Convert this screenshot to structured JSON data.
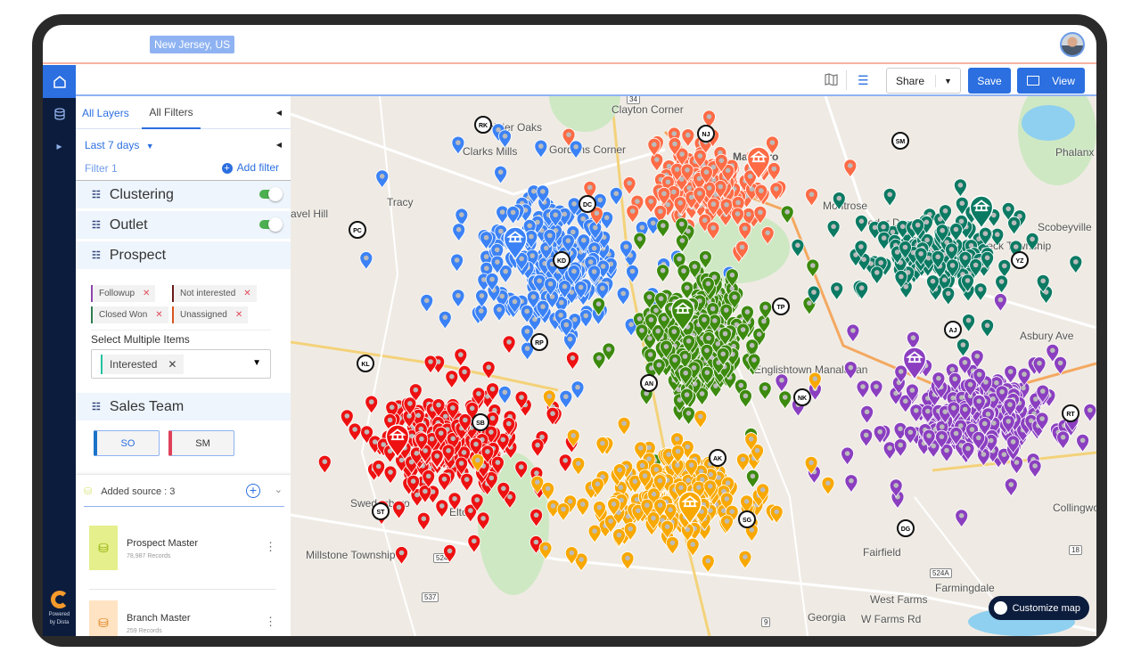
{
  "header": {
    "location": "New Jersey, US"
  },
  "toolbar": {
    "share_label": "Share",
    "save_label": "Save",
    "view_label": "View"
  },
  "panel": {
    "tabs": [
      {
        "label": "All Layers"
      },
      {
        "label": "All Filters"
      }
    ],
    "date_range": "Last 7 days",
    "filter_title": "Filter 1",
    "add_filter": "Add filter",
    "sections": {
      "clustering": "Clustering",
      "outlet": "Outlet",
      "prospect": "Prospect",
      "sales_team": "Sales Team"
    },
    "toggles": {
      "clustering": true,
      "outlet": true
    },
    "chips": [
      {
        "label": "Followup",
        "color": "#8e44ad"
      },
      {
        "label": "Not interested",
        "color": "#6b1a1a"
      },
      {
        "label": "Closed Won",
        "color": "#2e7d4f"
      },
      {
        "label": "Unassigned",
        "color": "#d9541e"
      }
    ],
    "select_label": "Select Multiple Items",
    "selected": "Interested",
    "team_buttons": [
      {
        "label": "SO",
        "color": "#1a73c8"
      },
      {
        "label": "SM",
        "color": "#e0405a"
      }
    ],
    "sources": {
      "header": "Added source : 3",
      "items": [
        {
          "name": "Prospect Master",
          "records": "78,987 Records",
          "color": "#e5ef8c",
          "icon_color": "#8fae00"
        },
        {
          "name": "Branch Master",
          "records": "259 Records",
          "color": "#ffe3c2",
          "icon_color": "#e0801a"
        }
      ]
    }
  },
  "logo": {
    "text1": "Powered",
    "text2": "by Dista"
  },
  "map": {
    "places": [
      "Whittier Oaks",
      "Clarks Mills",
      "Gordons Corner",
      "Clayton Corner",
      "Tracy",
      "avel Hill",
      "Marlboro",
      "Montrose",
      "Cedar Dr",
      "Colts Neck Township",
      "Scobeyville",
      "Phalanx",
      "Englishtown Manalapan",
      "Asbury Ave",
      "Collingwood Park",
      "Millstone Township",
      "Fairfield",
      "Farmingdale",
      "West Farms",
      "W Farms Rd",
      "Georgia",
      "Swedesboro",
      "Elton"
    ],
    "route_shields": [
      "34",
      "524",
      "537",
      "524A",
      "9",
      "18"
    ],
    "clusters": [
      {
        "name": "blue",
        "color": "#3b82f6"
      },
      {
        "name": "orange",
        "color": "#ff6b45"
      },
      {
        "name": "green",
        "color": "#3c8a0e"
      },
      {
        "name": "teal",
        "color": "#0b7a63"
      },
      {
        "name": "purple",
        "color": "#8b3fc0"
      },
      {
        "name": "red",
        "color": "#ee1111"
      },
      {
        "name": "yellow",
        "color": "#f9a800"
      }
    ],
    "user_markers": [
      "RK",
      "DC",
      "PC",
      "KD",
      "RP",
      "KL",
      "NJ",
      "SM",
      "YZ",
      "AJ",
      "TP",
      "AN",
      "NK",
      "SB",
      "AK",
      "ST",
      "SG",
      "DG",
      "RT"
    ],
    "customize_label": "Customize map"
  }
}
